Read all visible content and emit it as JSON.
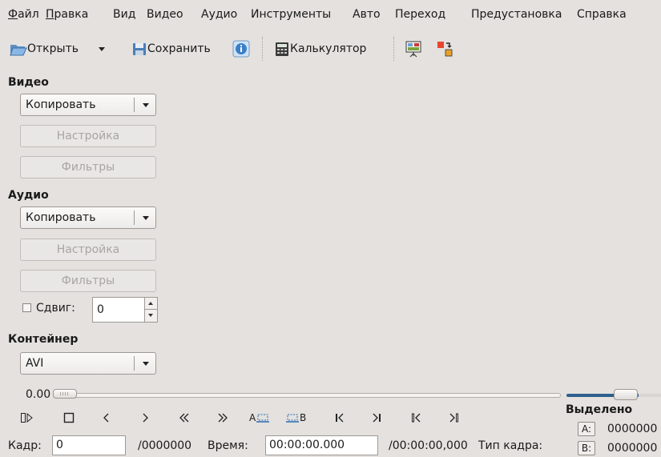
{
  "menu": [
    {
      "first": "Ф",
      "rest": "айл",
      "underline": true
    },
    {
      "first": "П",
      "rest": "равка",
      "underline": true
    },
    {
      "first": "В",
      "rest": "ид",
      "underline": false
    },
    {
      "first": "В",
      "rest": "идео",
      "underline": false
    },
    {
      "first": "А",
      "rest": "удио",
      "underline": false
    },
    {
      "first": "И",
      "rest": "нструменты",
      "underline": false
    },
    {
      "first": "А",
      "rest": "вто",
      "underline": false
    },
    {
      "first": "П",
      "rest": "ереход",
      "underline": false
    },
    {
      "first": "П",
      "rest": "редустановка",
      "underline": false
    },
    {
      "first": "С",
      "rest": "правка",
      "underline": false
    }
  ],
  "toolbar": {
    "open_label": "Открыть",
    "save_label": "Сохранить",
    "calculator_label": "Калькулятор"
  },
  "video": {
    "title": "Видео",
    "codec_value": "Копировать",
    "configure_label": "Настройка",
    "filters_label": "Фильтры"
  },
  "audio": {
    "title": "Аудио",
    "codec_value": "Копировать",
    "configure_label": "Настройка",
    "filters_label": "Фильтры",
    "shift_label": "Сдвиг:",
    "shift_value": "0",
    "shift_checked": false
  },
  "container": {
    "title": "Контейнер",
    "format_value": "AVI"
  },
  "timeline": {
    "position_value": "0.00",
    "position_fraction": 0.0,
    "volume_fraction": 0.5
  },
  "controls": {
    "mark_a_label": "A",
    "mark_b_label": "B"
  },
  "selection": {
    "title": "Выделено",
    "a_label": "A:",
    "a_value": "0000000",
    "b_label": "B:",
    "b_value": "0000000"
  },
  "status": {
    "frame_label": "Кадр:",
    "frame_value": "0",
    "frame_total": "/0000000",
    "time_label": "Время:",
    "time_value": "00:00:00.000",
    "time_total": "/00:00:00,000",
    "frame_type_label": "Тип кадра:"
  },
  "colors": {
    "background": "#e4e1de",
    "volume_fill": "#2e5f8e",
    "disabled_text": "#a8a5a2"
  }
}
